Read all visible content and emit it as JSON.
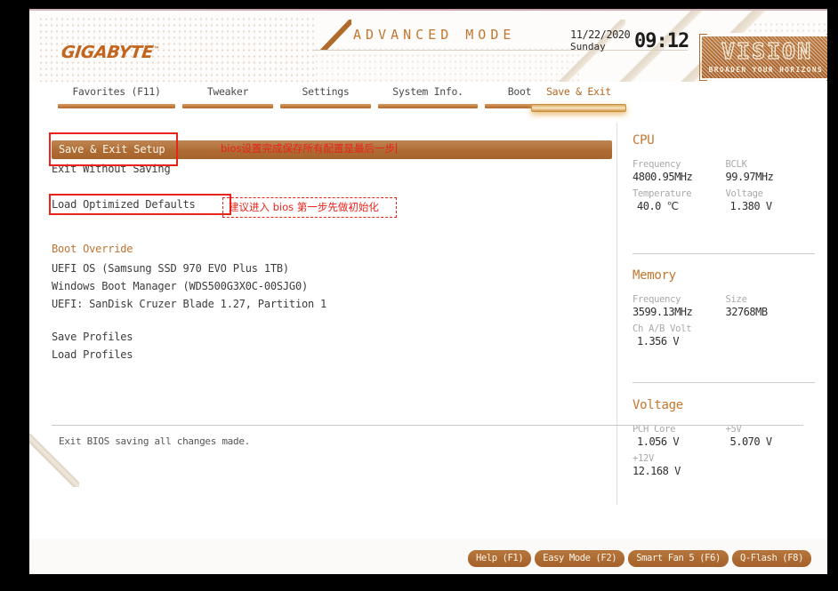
{
  "theme": {
    "accent": "#b5661f",
    "accent_bar": "#b1682c",
    "selection_bar": "#ae6c33",
    "annotation_red": "#e8231a",
    "screen_bg": "#ffffff",
    "frame_bg": "#000000",
    "value_text": "#2e2e2e",
    "key_text": "#a9a9a9"
  },
  "header": {
    "brand": "GIGABYTE",
    "brand_tm": "™",
    "mode_title": "ADVANCED MODE",
    "datetime": {
      "date": "11/22/2020",
      "weekday": "Sunday",
      "clock": "09:12"
    },
    "product_logo": {
      "word": "VISION",
      "tagline": "BROADEN YOUR HORIZONS"
    }
  },
  "nav": {
    "tabs": [
      {
        "label": "Favorites (F11)",
        "active": false
      },
      {
        "label": "Tweaker",
        "active": false
      },
      {
        "label": "Settings",
        "active": false
      },
      {
        "label": "System Info.",
        "active": false
      },
      {
        "label": "Boot",
        "active": false
      },
      {
        "label": "Save & Exit",
        "active": true
      }
    ]
  },
  "main": {
    "selected_item": "Save & Exit Setup",
    "items": [
      {
        "label": "Exit Without Saving",
        "heading": false
      },
      {
        "label": "Load Optimized Defaults",
        "heading": false
      },
      {
        "label": "Boot Override",
        "heading": true
      },
      {
        "label": "UEFI OS (Samsung SSD 970 EVO Plus 1TB)",
        "heading": false
      },
      {
        "label": "Windows Boot Manager (WDS500G3X0C-00SJG0)",
        "heading": false
      },
      {
        "label": "UEFI: SanDisk Cruzer Blade 1.27, Partition 1",
        "heading": false
      },
      {
        "label": "Save Profiles",
        "heading": false
      },
      {
        "label": "Load Profiles",
        "heading": false
      }
    ],
    "description": "Exit BIOS saving all changes made."
  },
  "annotations": [
    {
      "text": "bios设置完成保存所有配置是最后一步",
      "style": "plain-red-with-caret"
    },
    {
      "text": "建议进入 bios 第一步先做初始化",
      "style": "dashed-red-box"
    }
  ],
  "sidebar": {
    "sections": [
      {
        "title": "CPU",
        "fields": [
          {
            "key": "Frequency",
            "value": "4800.95MHz"
          },
          {
            "key": "BCLK",
            "value": "99.97MHz"
          },
          {
            "key": "Temperature",
            "value": "40.0 ℃"
          },
          {
            "key": "Voltage",
            "value": "1.380 V"
          }
        ]
      },
      {
        "title": "Memory",
        "fields": [
          {
            "key": "Frequency",
            "value": "3599.13MHz"
          },
          {
            "key": "Size",
            "value": "32768MB"
          },
          {
            "key": "Ch A/B Volt",
            "value": "1.356 V"
          }
        ]
      },
      {
        "title": "Voltage",
        "fields": [
          {
            "key": "PCH Core",
            "value": "1.056 V"
          },
          {
            "key": "+5V",
            "value": "5.070 V"
          },
          {
            "key": "+12V",
            "value": "12.168 V"
          }
        ]
      }
    ]
  },
  "footer": {
    "buttons": [
      {
        "label": "Help (F1)"
      },
      {
        "label": "Easy Mode (F2)"
      },
      {
        "label": "Smart Fan 5 (F6)"
      },
      {
        "label": "Q-Flash (F8)"
      }
    ]
  }
}
